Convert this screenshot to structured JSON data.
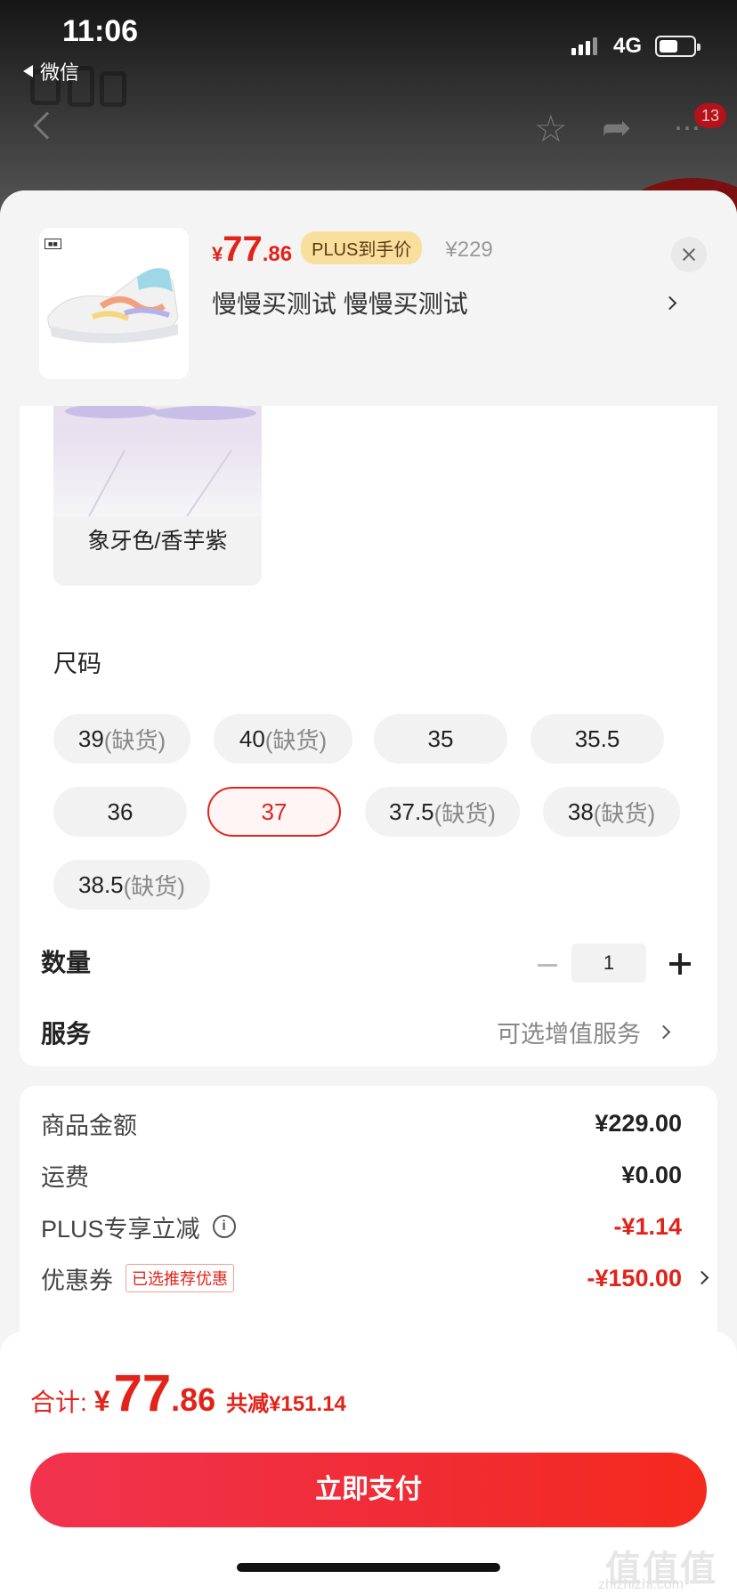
{
  "status_bar": {
    "time": "11:06",
    "back_app": "微信",
    "network": "4G"
  },
  "nav": {
    "cart_badge": "13"
  },
  "sheet": {
    "price": {
      "currency": "¥",
      "integer": "77",
      "decimal": ".86",
      "plus_tag": "PLUS到手价",
      "original": "¥229"
    },
    "selected_spec": "慢慢买测试  慢慢买测试",
    "color_option": {
      "label": "象牙色/香芋紫"
    },
    "size_title": "尺码",
    "out_of_stock_label": "(缺货)",
    "sizes": [
      {
        "label": "39",
        "suffix": "(缺货)"
      },
      {
        "label": "40",
        "suffix": "(缺货)"
      },
      {
        "label": "35",
        "suffix": ""
      },
      {
        "label": "35.5",
        "suffix": ""
      },
      {
        "label": "36",
        "suffix": ""
      },
      {
        "label": "37",
        "suffix": ""
      },
      {
        "label": "37.5",
        "suffix": "(缺货)"
      },
      {
        "label": "38",
        "suffix": "(缺货)"
      },
      {
        "label": "38.5",
        "suffix": "(缺货)"
      }
    ],
    "selected_size": "37",
    "quantity": {
      "label": "数量",
      "value": "1"
    },
    "service": {
      "label": "服务",
      "value": "可选增值服务"
    }
  },
  "summary": {
    "goods_amount": {
      "label": "商品金额",
      "value": "¥229.00"
    },
    "shipping": {
      "label": "运费",
      "value": "¥0.00"
    },
    "plus_discount": {
      "label": "PLUS专享立减",
      "value": "-¥1.14"
    },
    "coupon": {
      "label": "优惠券",
      "tag": "已选推荐优惠",
      "value": "-¥150.00"
    }
  },
  "footer": {
    "total_label": "合计:",
    "currency": "¥",
    "total_integer": "77",
    "total_decimal": ".86",
    "saved": "共减¥151.14",
    "pay_button": "立即支付",
    "watermark": "值值值",
    "watermark_url": "zhizhizhi.com"
  },
  "colors": {
    "accent": "#e2231a",
    "plus_gold": "#f9df9e",
    "pay_gradient_start": "#f1334f",
    "pay_gradient_end": "#f52a1e"
  }
}
